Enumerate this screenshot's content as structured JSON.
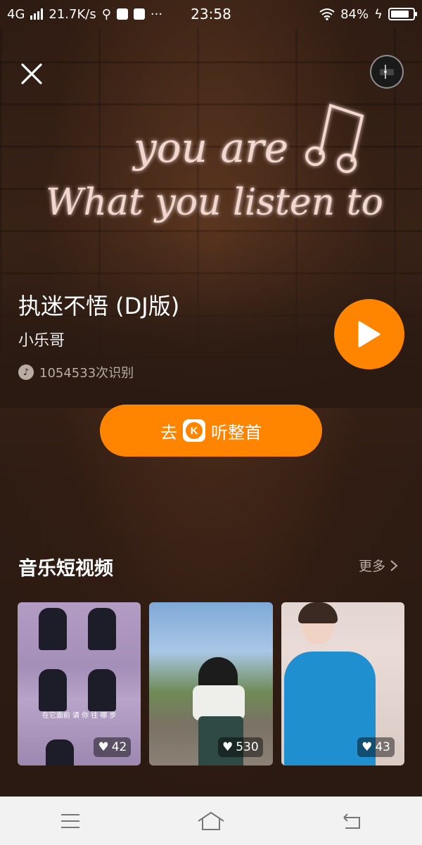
{
  "status": {
    "network": "4G",
    "speed": "21.7K/s",
    "time": "23:58",
    "battery": "84%",
    "battery_level": 0.84
  },
  "hero": {
    "neon_line1": "you are",
    "neon_line2": "What you listen to"
  },
  "song": {
    "title": "执迷不悟 (DJ版)",
    "artist": "小乐哥",
    "recognition_count": "1054533次识别"
  },
  "actions": {
    "listen_prefix": "去",
    "listen_app_letter": "K",
    "listen_suffix": "听整首"
  },
  "section": {
    "title": "音乐短视频",
    "more_label": "更多"
  },
  "videos": [
    {
      "likes": "42",
      "caption": "在它面前 请 你 往 哪 步"
    },
    {
      "likes": "530"
    },
    {
      "likes": "43"
    }
  ],
  "colors": {
    "accent": "#ff8400",
    "background": "#2a1a12"
  },
  "icons": [
    "close-icon",
    "disc-icon",
    "play-icon",
    "music-note-icon",
    "chevron-right-icon",
    "heart-icon",
    "menu-icon",
    "home-icon",
    "back-icon"
  ]
}
